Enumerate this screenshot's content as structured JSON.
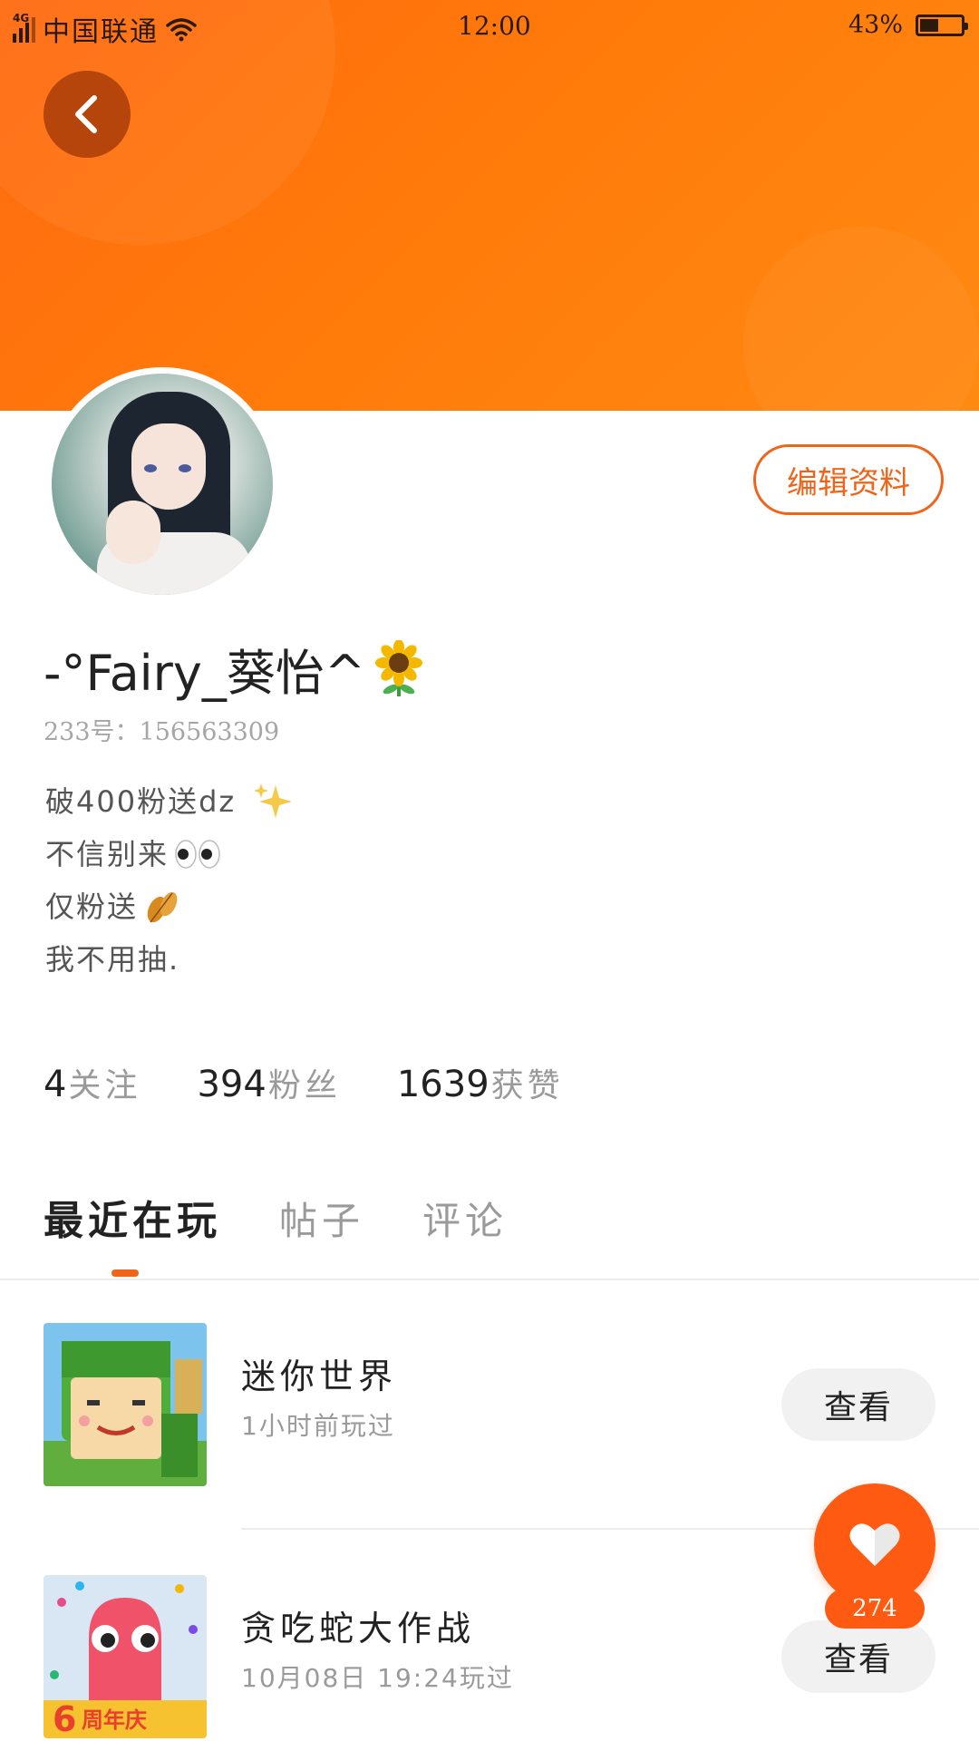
{
  "status_bar": {
    "network": "4G",
    "carrier": "中国联通",
    "time": "12:00",
    "battery": "43%"
  },
  "profile": {
    "username": "-°Fairy_葵怡^",
    "user_id": "233号：156563309",
    "edit_label": "编辑资料",
    "bio": [
      "破400粉送dz",
      "不信别来",
      "仅粉送",
      "我不用抽."
    ]
  },
  "stats": [
    {
      "value": "4",
      "label": "关注"
    },
    {
      "value": "394",
      "label": "粉丝"
    },
    {
      "value": "1639",
      "label": "获赞"
    }
  ],
  "tabs": [
    {
      "label": "最近在玩",
      "active": true
    },
    {
      "label": "帖子",
      "active": false
    },
    {
      "label": "评论",
      "active": false
    }
  ],
  "games": [
    {
      "title": "迷你世界",
      "meta": "1小时前玩过",
      "action": "查看"
    },
    {
      "title": "贪吃蛇大作战",
      "meta": "10月08日 19:24玩过",
      "action": "查看"
    }
  ],
  "snake_badge": "6周年庆",
  "like": {
    "count": "274"
  },
  "colors": {
    "accent": "#f0641a",
    "banner": "#ff7a0a",
    "fab": "#ff5a12"
  }
}
